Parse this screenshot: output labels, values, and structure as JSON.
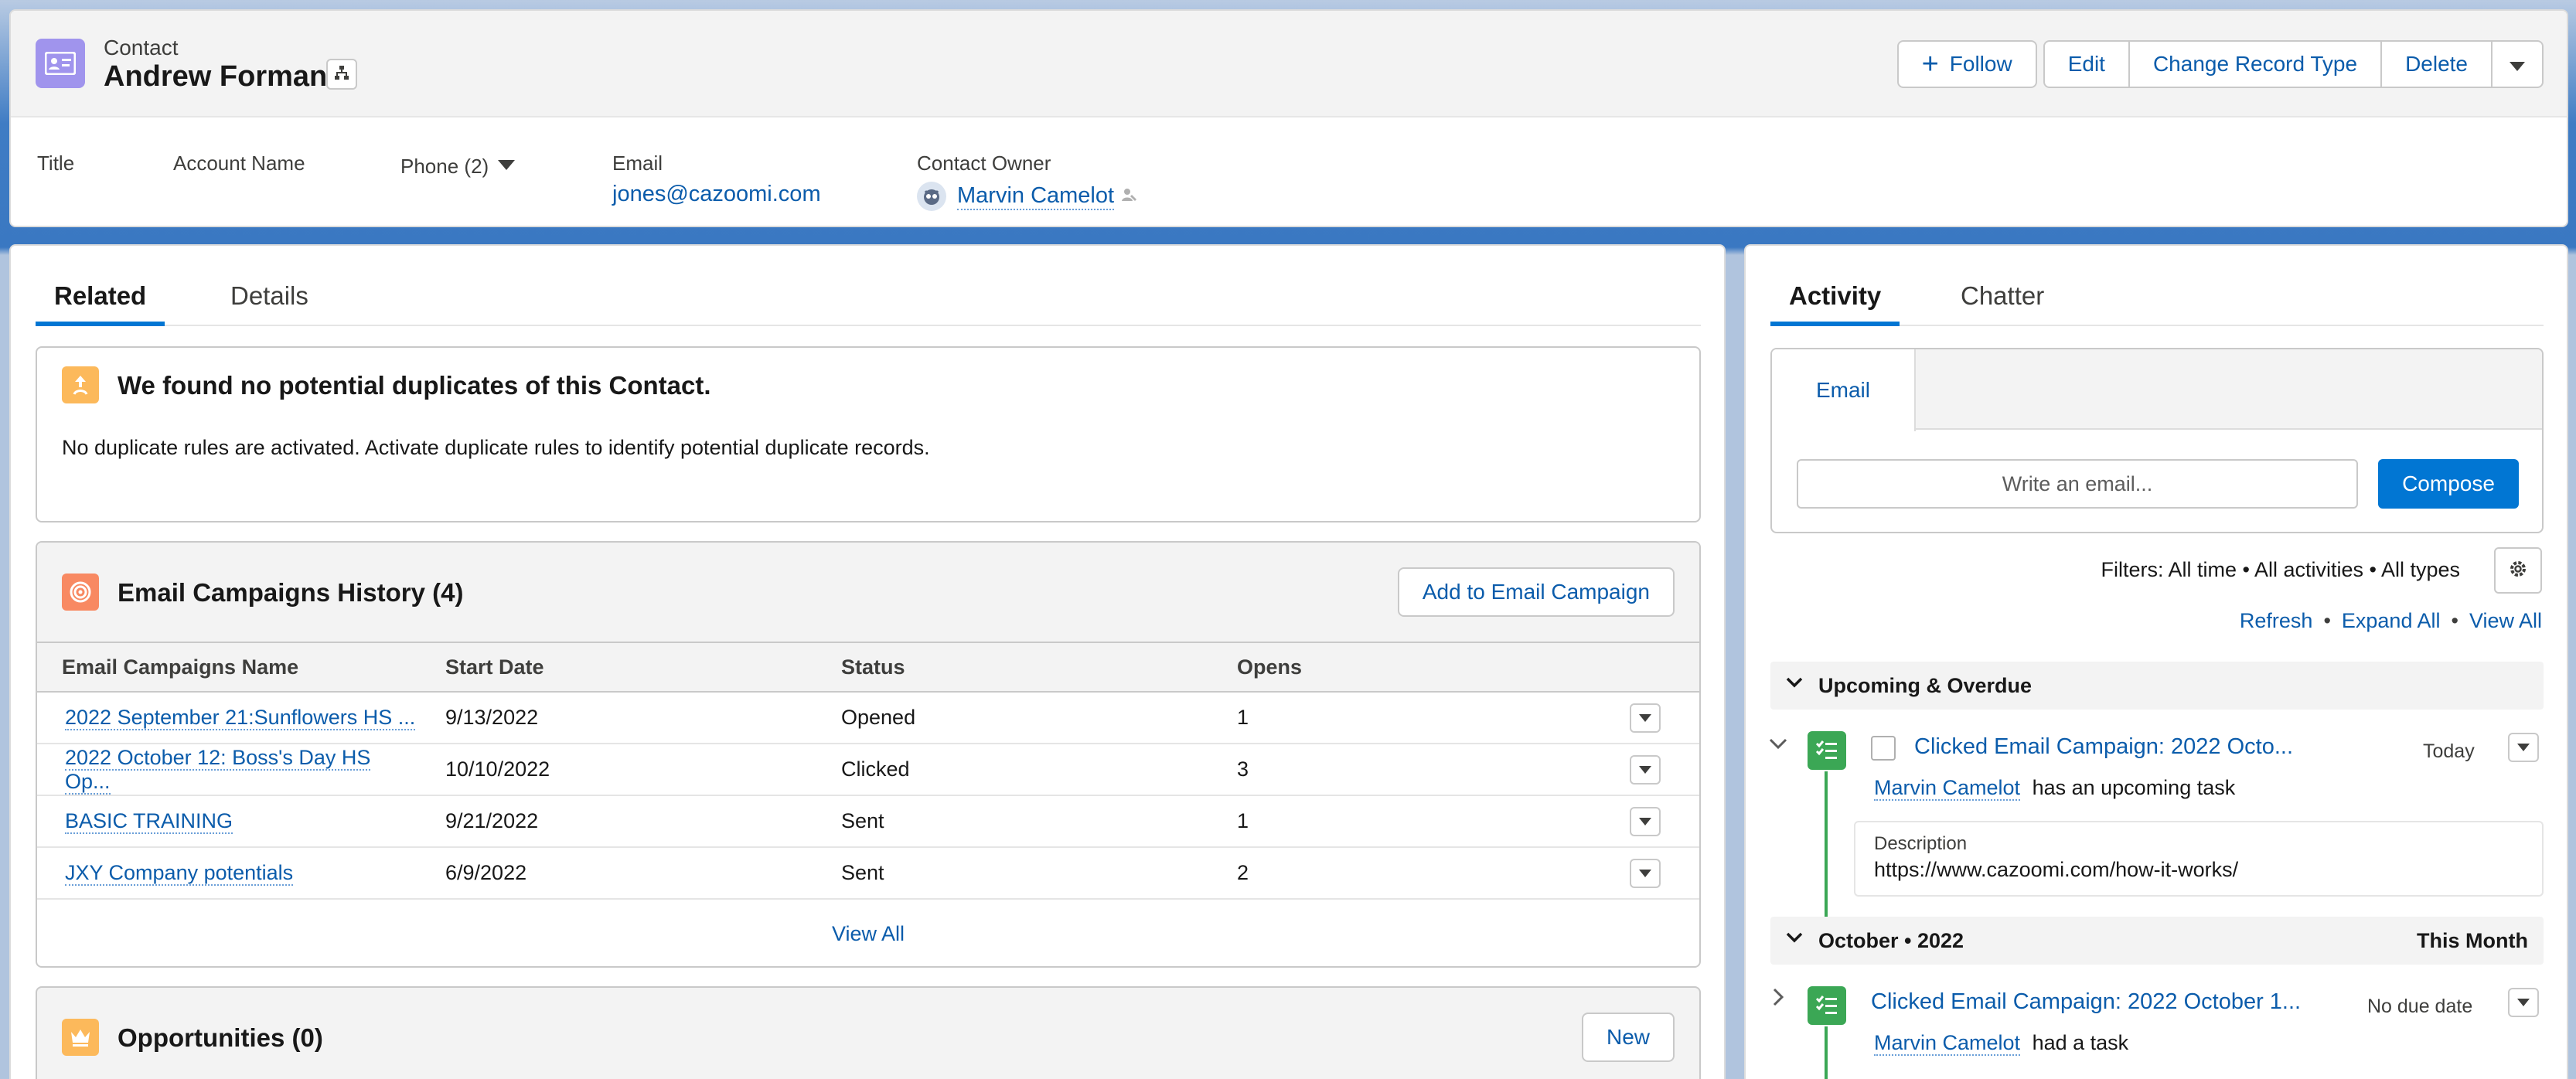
{
  "header": {
    "object_label": "Contact",
    "record_name": "Andrew Forman",
    "actions": {
      "follow": "Follow",
      "edit": "Edit",
      "change_record_type": "Change Record Type",
      "delete": "Delete"
    },
    "fields": {
      "title_label": "Title",
      "account_name_label": "Account Name",
      "phone_label": "Phone (2)",
      "email_label": "Email",
      "email_value": "jones@cazoomi.com",
      "owner_label": "Contact Owner",
      "owner_value": "Marvin Camelot"
    }
  },
  "left_tabs": {
    "related": "Related",
    "details": "Details"
  },
  "duplicates": {
    "title": "We found no potential duplicates of this Contact.",
    "message": "No duplicate rules are activated. Activate duplicate rules to identify potential duplicate records."
  },
  "email_campaigns": {
    "title": "Email Campaigns History (4)",
    "add_button": "Add to Email Campaign",
    "columns": [
      "Email Campaigns Name",
      "Start Date",
      "Status",
      "Opens"
    ],
    "rows": [
      {
        "name": "2022 September 21:Sunflowers HS ...",
        "start_date": "9/13/2022",
        "status": "Opened",
        "opens": "1"
      },
      {
        "name": "2022 October 12: Boss's Day HS Op...",
        "start_date": "10/10/2022",
        "status": "Clicked",
        "opens": "3"
      },
      {
        "name": "BASIC TRAINING",
        "start_date": "9/21/2022",
        "status": "Sent",
        "opens": "1"
      },
      {
        "name": "JXY Company potentials",
        "start_date": "6/9/2022",
        "status": "Sent",
        "opens": "2"
      }
    ],
    "view_all": "View All"
  },
  "opportunities": {
    "title": "Opportunities (0)",
    "new_button": "New"
  },
  "right_tabs": {
    "activity": "Activity",
    "chatter": "Chatter"
  },
  "composer": {
    "tab": "Email",
    "placeholder": "Write an email...",
    "compose_button": "Compose"
  },
  "filters": {
    "text": "Filters: All time • All activities • All types",
    "refresh": "Refresh",
    "expand_all": "Expand All",
    "view_all": "View All",
    "sep": "•"
  },
  "timeline": {
    "upcoming_label": "Upcoming & Overdue",
    "item1": {
      "title": "Clicked Email Campaign: 2022 Octo...",
      "date": "Today",
      "owner": "Marvin Camelot",
      "suffix": "has an upcoming task",
      "desc_label": "Description",
      "desc_value": "https://www.cazoomi.com/how-it-works/"
    },
    "month_label": "October • 2022",
    "month_right": "This Month",
    "item2": {
      "title": "Clicked Email Campaign: 2022 October 1...",
      "date": "No due date",
      "owner": "Marvin Camelot",
      "suffix": "had a task"
    }
  },
  "colors": {
    "link": "#0b5cab",
    "brand": "#0176d3",
    "contact_icon": "#a094ed",
    "duplicate_icon": "#fcb95b",
    "campaign_icon": "#f88962",
    "opportunity_icon": "#fcb95b",
    "task_icon": "#3ba755"
  }
}
